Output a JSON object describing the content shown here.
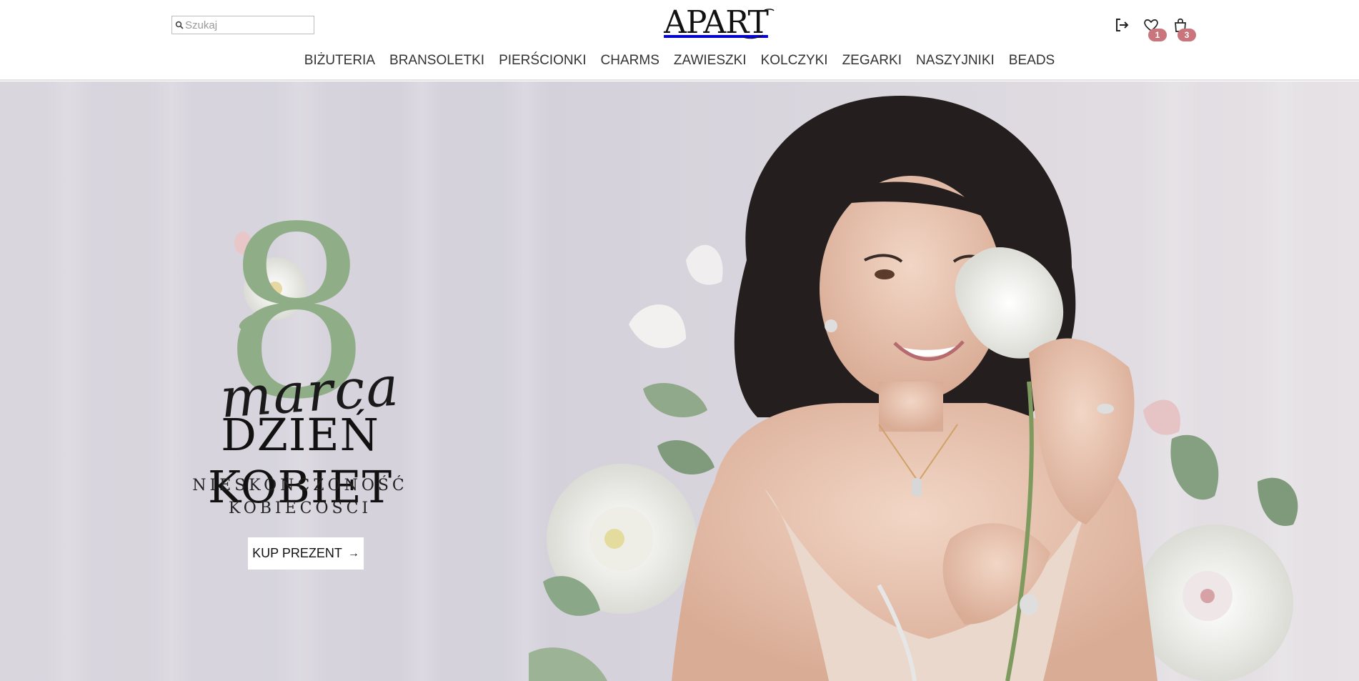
{
  "search": {
    "placeholder": "Szukaj"
  },
  "brand": {
    "logo": "APART"
  },
  "header_icons": {
    "logout": "logout-icon",
    "wishlist": "heart-icon",
    "cart": "bag-icon",
    "wishlist_count": "1",
    "cart_count": "3",
    "badge_color": "#c9757b"
  },
  "nav": {
    "items": [
      {
        "label": "BIŻUTERIA"
      },
      {
        "label": "BRANSOLETKI"
      },
      {
        "label": "PIERŚCIONKI"
      },
      {
        "label": "CHARMS"
      },
      {
        "label": "ZAWIESZKI"
      },
      {
        "label": "KOLCZYKI"
      },
      {
        "label": "ZEGARKI"
      },
      {
        "label": "NASZYJNIKI"
      },
      {
        "label": "BEADS"
      }
    ]
  },
  "hero": {
    "number": "8",
    "script": "marca",
    "headline": "DZIEŃ KOBIET",
    "sub_line_1": "NIESKOŃCZONOŚĆ",
    "sub_line_2": "KOBIECOŚCI",
    "cta_label": "KUP PREZENT",
    "cta_arrow": "→",
    "accent_color": "#8fae88"
  }
}
